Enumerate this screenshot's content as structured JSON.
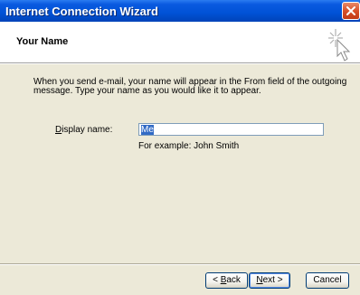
{
  "window": {
    "title": "Internet Connection Wizard"
  },
  "header": {
    "title": "Your Name"
  },
  "content": {
    "intro": "When you send e-mail, your name will appear in the From field of the outgoing message. Type your name as you would like it to appear.",
    "display_name_label": "Display name:",
    "display_name_value": "Me",
    "example": "For example: John Smith"
  },
  "buttons": {
    "back": "< Back",
    "next": "Next >",
    "cancel": "Cancel"
  },
  "colors": {
    "titlebar": "#0052d6",
    "dialog_bg": "#ece9d8",
    "selection": "#316ac5"
  },
  "icons": {
    "close": "close-icon",
    "wizard": "wizard-cursor-icon"
  }
}
